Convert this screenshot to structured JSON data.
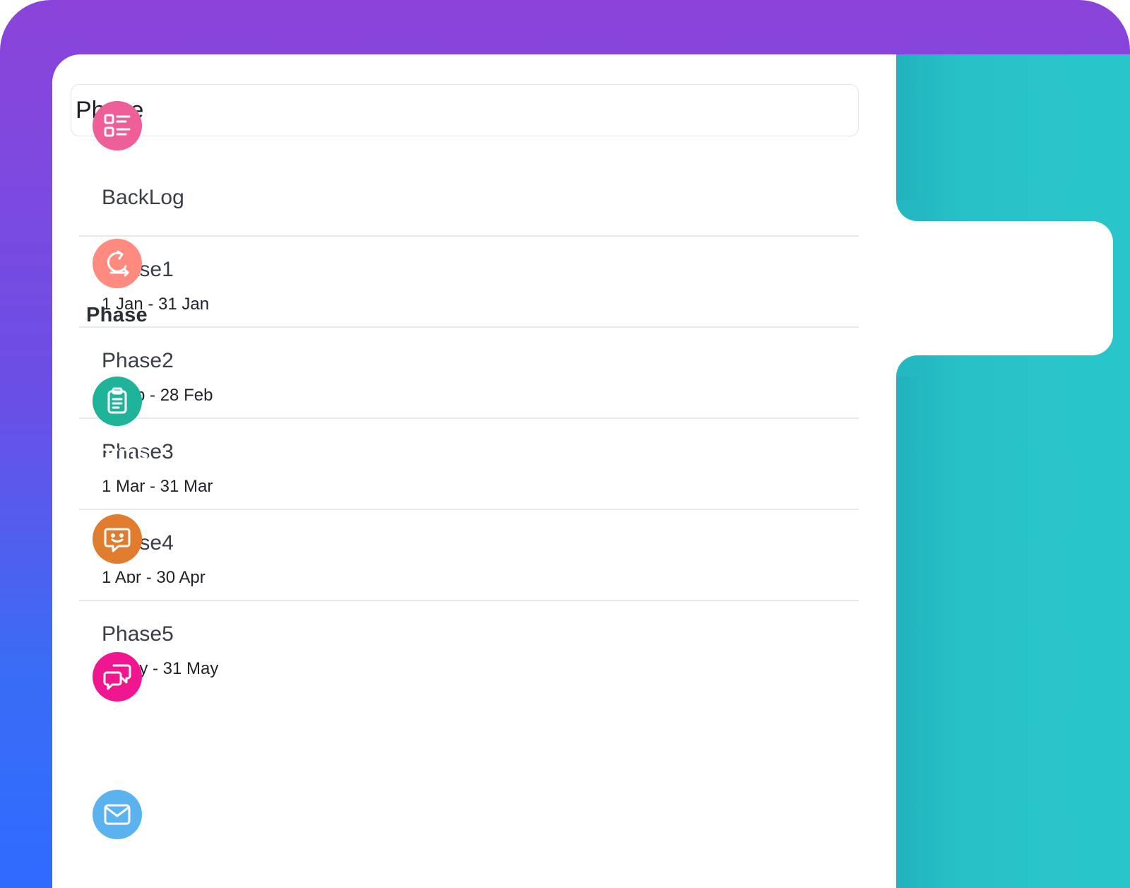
{
  "search": {
    "value": "Phase",
    "placeholder": ""
  },
  "phases": {
    "backlog": {
      "name": "BackLog"
    },
    "items": [
      {
        "name": "Phase1",
        "dates": "1 Jan - 31 Jan"
      },
      {
        "name": "Phase2",
        "dates": "1 Feb - 28 Feb"
      },
      {
        "name": "Phase3",
        "dates": "1 Mar - 31 Mar"
      },
      {
        "name": "Phase4",
        "dates": "1 Apr - 30 Apr"
      },
      {
        "name": "Phase5",
        "dates": "1 May - 31 May"
      }
    ]
  },
  "sidebar": {
    "active": "Phase",
    "items": [
      {
        "label": "Attributes",
        "icon": "attributes-list-icon",
        "color": "#ee5f9a"
      },
      {
        "label": "Phase",
        "icon": "phase-cycle-icon",
        "color": "#ff8a80"
      },
      {
        "label": "Forms",
        "icon": "clipboard-icon",
        "color": "#1fb39a"
      },
      {
        "label": "Chat Bot",
        "icon": "chat-bot-icon",
        "color": "#e07c2e"
      },
      {
        "label": "Channels",
        "icon": "channels-chat-icon",
        "color": "#f0168f"
      },
      {
        "label": "Email",
        "icon": "email-envelope-icon",
        "color": "#5ab2ee"
      }
    ]
  },
  "colors": {
    "frame_gradient_top": "#8b43d9",
    "frame_gradient_bottom": "#2f6bff",
    "sidebar_teal": "#27c2c8"
  }
}
